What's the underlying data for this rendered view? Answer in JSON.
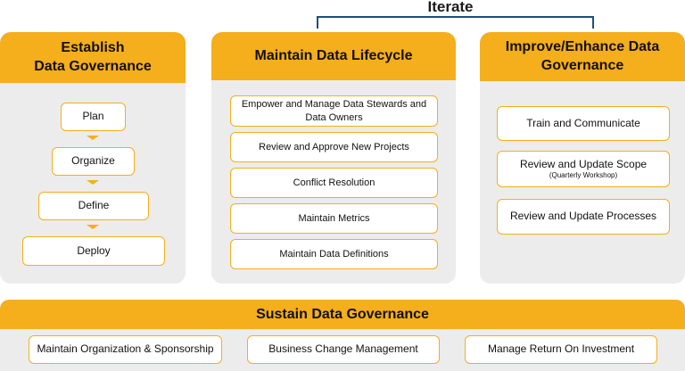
{
  "iterate": {
    "label": "Iterate"
  },
  "establish": {
    "title_line1": "Establish",
    "title_line2": "Data Governance",
    "steps": [
      "Plan",
      "Organize",
      "Define",
      "Deploy"
    ]
  },
  "maintain": {
    "title": "Maintain Data Lifecycle",
    "items": [
      "Empower and Manage Data Stewards and",
      "Data Owners",
      "Review and Approve New Projects",
      "Conflict Resolution",
      "Maintain Metrics",
      "Maintain Data Definitions"
    ]
  },
  "improve": {
    "title_line1": "Improve/Enhance Data",
    "title_line2": "Governance",
    "items": [
      "Train and Communicate",
      "Review and Update Scope",
      "Review and Update Processes"
    ],
    "scope_note": "(Quarterly Workshop)"
  },
  "sustain": {
    "title": "Sustain Data Governance",
    "items": [
      "Maintain Organization & Sponsorship",
      "Business Change Management",
      "Manage Return On Investment"
    ]
  },
  "colors": {
    "accent": "#f5ae1c",
    "panel": "#ececec",
    "bracket": "#1f4e79"
  }
}
